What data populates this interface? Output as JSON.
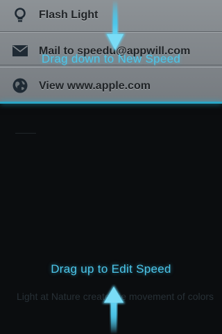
{
  "actions": [
    {
      "label": "Flash Light",
      "icon": "lightbulb-icon"
    },
    {
      "label": "Mail to speedu@appwill.com",
      "icon": "envelope-icon"
    },
    {
      "label": "View www.apple.com",
      "icon": "globe-icon"
    }
  ],
  "hints": {
    "drag_down": "Drag down to New Speed",
    "drag_up": "Drag up to Edit Speed"
  },
  "background": {
    "caption": "Light at Nature create the movement of colors"
  },
  "colors": {
    "accent": "#4cc6ea",
    "list_background": "#858a8e",
    "panel_background": "#0b0d0f"
  }
}
